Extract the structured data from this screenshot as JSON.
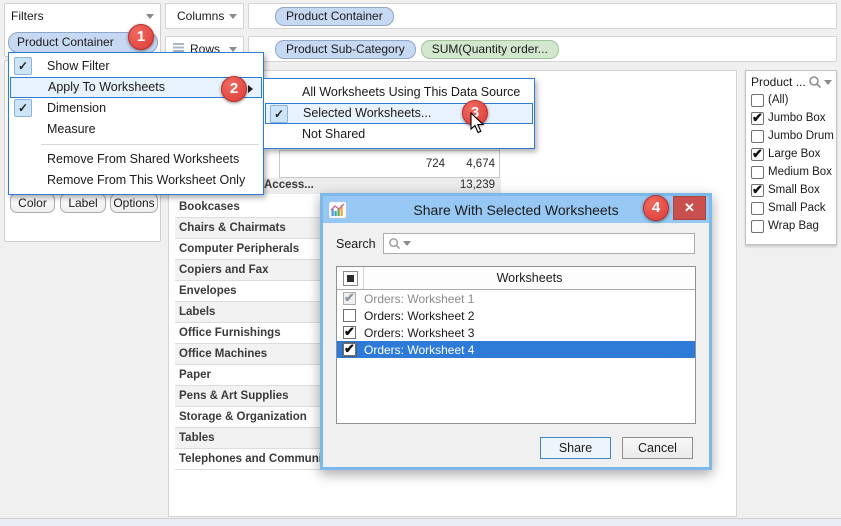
{
  "shelves": {
    "columns": {
      "label": "Columns",
      "pills": [
        {
          "label": "Product Container",
          "type": "dimension"
        }
      ]
    },
    "rows": {
      "label": "Rows",
      "pills": [
        {
          "label": "Product Sub-Category",
          "type": "dimension"
        },
        {
          "label": "SUM(Quantity order...",
          "type": "measure"
        }
      ]
    }
  },
  "filters_card": {
    "title": "Filters",
    "pill": "Product Container"
  },
  "marks_card": {
    "buttons": [
      "Color",
      "Label",
      "Options"
    ]
  },
  "context_menu": {
    "items": [
      {
        "label": "Show Filter",
        "checked": true
      },
      {
        "label": "Apply To Worksheets",
        "highlighted": true,
        "submenu": true
      },
      {
        "label": "Dimension",
        "checked": true
      },
      {
        "label": "Measure"
      },
      {
        "separator": true
      },
      {
        "label": "Remove From Shared Worksheets"
      },
      {
        "label": "Remove From This Worksheet Only"
      }
    ]
  },
  "sub_menu": {
    "items": [
      {
        "label": "All Worksheets Using This Data Source"
      },
      {
        "label": "Selected Worksheets...",
        "checked": true,
        "highlighted": true
      },
      {
        "label": "Not Shared"
      }
    ]
  },
  "crosstab": {
    "partial_values_row": [
      "724",
      "4,674"
    ],
    "access_row": {
      "label": "Access...",
      "value": "13,239"
    },
    "categories": [
      "Bookcases",
      "Chairs & Chairmats",
      "Computer Peripherals",
      "Copiers and Fax",
      "Envelopes",
      "Labels",
      "Office Furnishings",
      "Office Machines",
      "Paper",
      "Pens & Art Supplies",
      "Storage & Organization",
      "Tables",
      "Telephones and Communica..."
    ]
  },
  "quick_filter": {
    "title": "Product ...",
    "items": [
      {
        "label": "(All)",
        "checked": false
      },
      {
        "label": "Jumbo Box",
        "checked": true
      },
      {
        "label": "Jumbo Drum",
        "checked": false
      },
      {
        "label": "Large Box",
        "checked": true
      },
      {
        "label": "Medium Box",
        "checked": false
      },
      {
        "label": "Small Box",
        "checked": true
      },
      {
        "label": "Small Pack",
        "checked": false
      },
      {
        "label": "Wrap Bag",
        "checked": false
      }
    ]
  },
  "dialog": {
    "title": "Share With Selected Worksheets",
    "search_label": "Search",
    "search_value": "",
    "list_header": "Worksheets",
    "rows": [
      {
        "label": "Orders: Worksheet 1",
        "checked": true,
        "disabled": true
      },
      {
        "label": "Orders: Worksheet 2",
        "checked": false
      },
      {
        "label": "Orders: Worksheet 3",
        "checked": true
      },
      {
        "label": "Orders: Worksheet 4",
        "checked": true,
        "selected": true
      }
    ],
    "share_label": "Share",
    "cancel_label": "Cancel",
    "close_glyph": "✕"
  },
  "badges": {
    "one": "1",
    "two": "2",
    "three": "3",
    "four": "4"
  },
  "colors": {
    "accent_blue": "#2a7cd4",
    "badge_red": "#dd3b36",
    "selection_blue": "#2e7bd7",
    "dimension_pill": "#c6d8f2",
    "measure_pill": "#d3e7cf",
    "dialog_titlebar": "#96c8f3",
    "close_red": "#c9504e"
  }
}
